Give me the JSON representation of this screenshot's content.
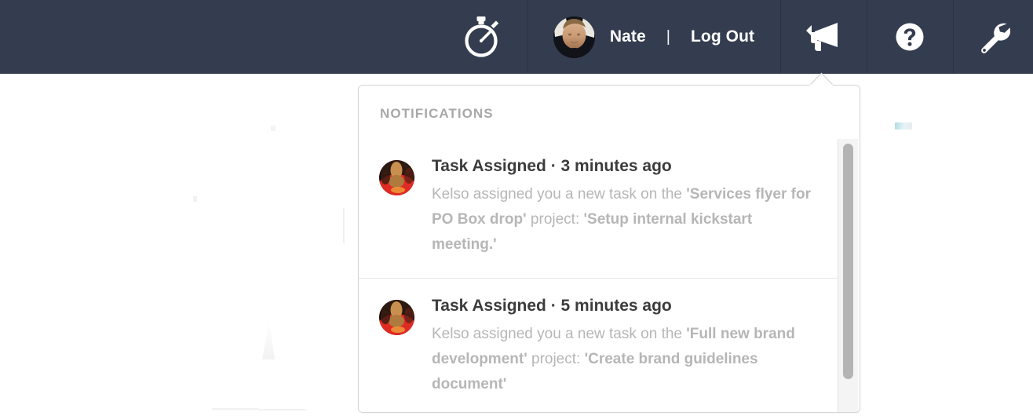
{
  "colors": {
    "topbar_bg": "#343d4f",
    "topbar_divider": "#2b3342",
    "topbar_text": "#ffffff",
    "panel_bg": "#ffffff",
    "panel_border": "#d6d6d6",
    "panel_title": "#a8a8a8",
    "notif_title": "#3c3c3c",
    "notif_body": "#b6b6b6",
    "divider": "#e7e7e7",
    "scrollbar_track": "#f4f4f4",
    "scrollbar_thumb": "#b4b4b4",
    "page_bg": "#ffffff"
  },
  "topbar": {
    "timer": {
      "icon": "stopwatch-icon",
      "label": "Timer"
    },
    "user": {
      "avatar": "user-avatar",
      "name": "Nate",
      "separator": "|",
      "logout_label": "Log Out"
    },
    "announcements": {
      "icon": "megaphone-icon",
      "label": "Announcements"
    },
    "help": {
      "icon": "question-circle-icon",
      "label": "Help"
    },
    "tools": {
      "icon": "wrench-icon",
      "label": "Tools"
    }
  },
  "notifications_panel": {
    "title": "NOTIFICATIONS",
    "items": [
      {
        "avatar": "kelso-avatar",
        "heading": "Task Assigned · 3 minutes ago",
        "body_parts": [
          {
            "text": "Kelso assigned you a new task on the ",
            "bold": false
          },
          {
            "text": "'Services flyer for PO Box drop'",
            "bold": true
          },
          {
            "text": " project: ",
            "bold": false
          },
          {
            "text": "'Setup internal kickstart meeting.'",
            "bold": true
          }
        ],
        "plain_body": "Kelso assigned you a new task on the 'Services flyer for PO Box drop' project: 'Setup internal kickstart meeting.'"
      },
      {
        "avatar": "kelso-avatar",
        "heading": "Task Assigned · 5 minutes ago",
        "body_parts": [
          {
            "text": "Kelso assigned you a new task on the ",
            "bold": false
          },
          {
            "text": "'Full new brand development'",
            "bold": true
          },
          {
            "text": " project: ",
            "bold": false
          },
          {
            "text": "'Create brand guidelines document'",
            "bold": true
          }
        ],
        "plain_body": "Kelso assigned you a new task on the 'Full new brand development' project: 'Create brand guidelines document'"
      }
    ],
    "scrollbar": {
      "thumb_position": "top",
      "thumb_fraction": 0.86
    }
  }
}
